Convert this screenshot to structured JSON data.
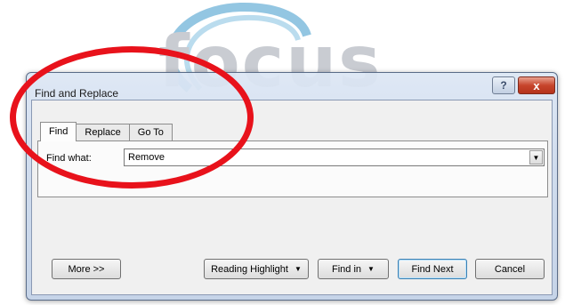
{
  "logo": {
    "text": "focus"
  },
  "dialog": {
    "title": "Find and Replace",
    "help_glyph": "?",
    "close_glyph": "x"
  },
  "tabs": [
    {
      "label": "Find",
      "active": true
    },
    {
      "label": "Replace",
      "active": false
    },
    {
      "label": "Go To",
      "active": false
    }
  ],
  "find": {
    "label": "Find what:",
    "value": "Remove"
  },
  "buttons": {
    "more": "More >>",
    "reading_highlight": "Reading Highlight",
    "find_in": "Find in",
    "find_next": "Find Next",
    "cancel": "Cancel"
  },
  "colors": {
    "annotation": "#e8121b",
    "logo_swirl": "#6fb3d8"
  },
  "icons": [
    "dropdown-arrow-icon",
    "help-icon",
    "close-icon"
  ]
}
